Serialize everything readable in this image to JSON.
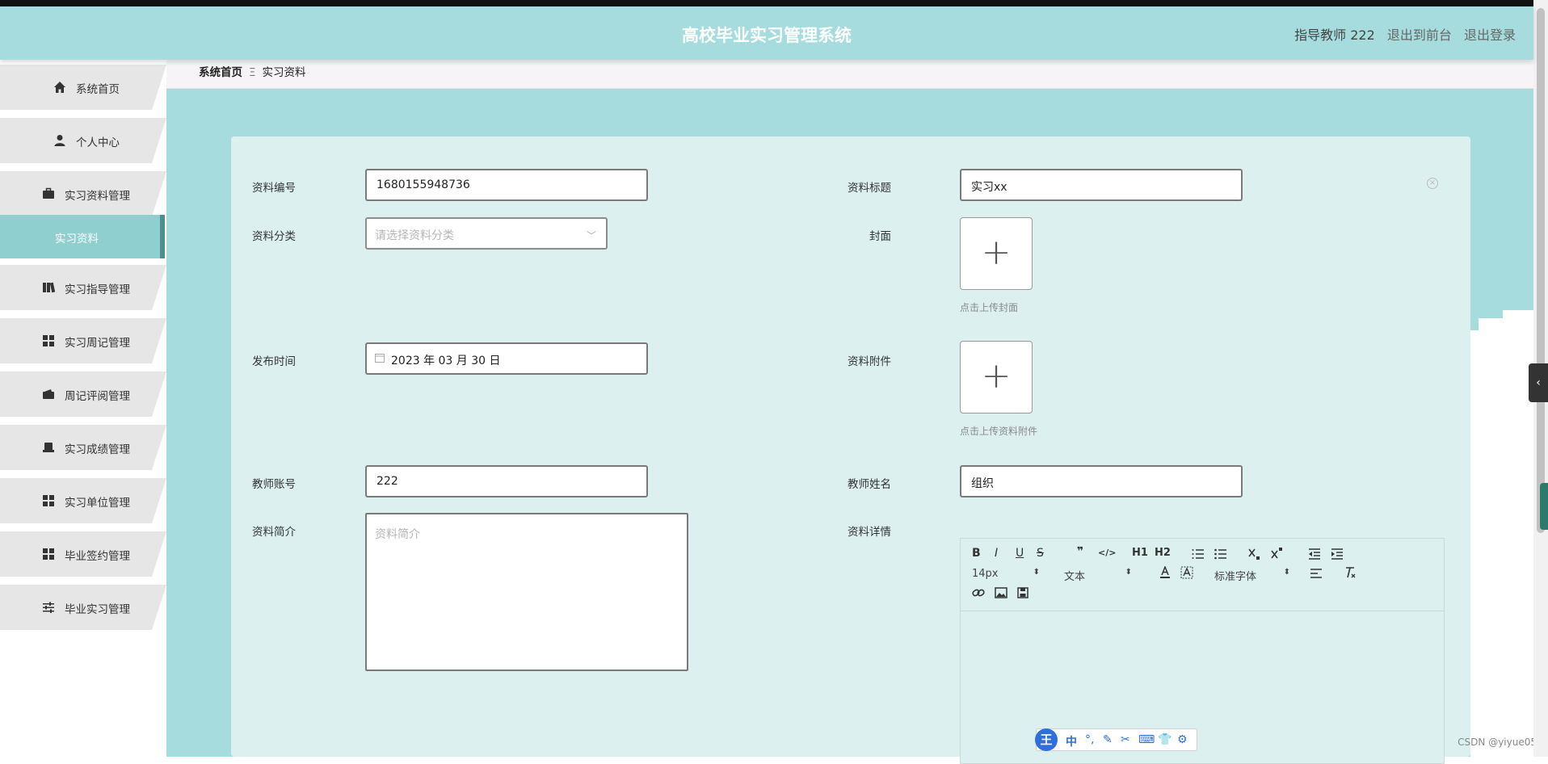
{
  "header": {
    "title": "高校毕业实习管理系统",
    "user": "指导教师 222",
    "back_front": "退出到前台",
    "logout": "退出登录"
  },
  "sidebar": {
    "items": [
      {
        "label": "系统首页",
        "icon": "home-icon"
      },
      {
        "label": "个人中心",
        "icon": "user-icon"
      },
      {
        "label": "实习资料管理",
        "icon": "briefcase-icon"
      },
      {
        "label": "实习指导管理",
        "icon": "book-icon"
      },
      {
        "label": "实习周记管理",
        "icon": "grid-icon"
      },
      {
        "label": "周记评阅管理",
        "icon": "wallet-icon"
      },
      {
        "label": "实习成绩管理",
        "icon": "printer-icon"
      },
      {
        "label": "实习单位管理",
        "icon": "grid-icon"
      },
      {
        "label": "毕业签约管理",
        "icon": "grid-icon"
      },
      {
        "label": "毕业实习管理",
        "icon": "sliders-icon"
      }
    ],
    "active_sub": "实习资料"
  },
  "breadcrumb": {
    "home": "系统首页",
    "separator": "Ξ",
    "current": "实习资料"
  },
  "form": {
    "code_label": "资料编号",
    "code_value": "1680155948736",
    "title_label": "资料标题",
    "title_value": "实习xx",
    "category_label": "资料分类",
    "category_placeholder": "请选择资料分类",
    "cover_label": "封面",
    "cover_hint": "点击上传封面",
    "publish_label": "发布时间",
    "publish_value": "2023 年 03 月 30 日",
    "attach_label": "资料附件",
    "attach_hint": "点击上传资料附件",
    "teacher_account_label": "教师账号",
    "teacher_account_value": "222",
    "teacher_name_label": "教师姓名",
    "teacher_name_value": "组织",
    "summary_label": "资料简介",
    "summary_placeholder": "资料简介",
    "detail_label": "资料详情"
  },
  "editor": {
    "font_size": "14px",
    "text_style": "文本",
    "font_family": "标准字体",
    "buttons": [
      "B",
      "I",
      "U",
      "S",
      "❞",
      "</>",
      "H1",
      "H2"
    ]
  },
  "ime": {
    "logo": "王",
    "mode": "中"
  },
  "watermark": "CSDN @yiyue05",
  "colors": {
    "header_bg": "#a6dcdd",
    "sidebar_active": "#8fcfd0",
    "panel_bg": "#dcf0f0"
  }
}
